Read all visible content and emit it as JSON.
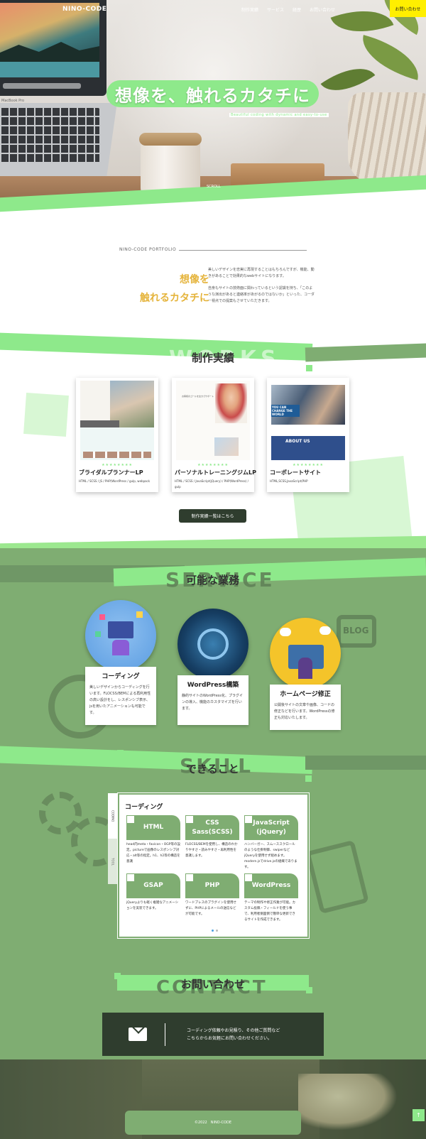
{
  "header": {
    "logo": "NINO-CODE",
    "nav": [
      "制作実績",
      "サービス",
      "経歴",
      "お問い合わせ"
    ],
    "contact_button": "お問い合わせ"
  },
  "hero": {
    "title": "想像を、触れるカタチに",
    "subtitle": "Beautiful coding with dynamic and easy-to-use",
    "scroll": "SCROLL",
    "laptop_label": "MacBook Pro"
  },
  "about": {
    "heading": "NINO-CODE PORTFOLIO",
    "tagline": [
      "想像を",
      "触れるカタチに"
    ],
    "paragraphs": [
      "美しいデザインを忠実に再現することはもちろんですが、機能、動きがあることで効果的なwebサイトになります。",
      "自身もサイトの技術面に関わっているという認識を持ち、「このような演出があると連絡率があがるのではないか」といった、コーダー視点での提案もさせていただきます。"
    ]
  },
  "works": {
    "ghost": "WORKS",
    "title": "制作実績",
    "cards": [
      {
        "title": "ブライダルプランナーLP",
        "tags": "HTML / SCSS / JS / PHP(WordPress / gulp, webpack",
        "stars": "★★★★★★★★"
      },
      {
        "title": "パーソナルトレーニングジムLP",
        "tags": "HTML / SCSS / JavaScript(jQuery) / PHP(WordPress) / gulp",
        "stars": "★★★★★★★★"
      },
      {
        "title": "コーポレートサイト",
        "tags": "HTML,SCSS,JavaScript(PHP",
        "stars": "★★★★★★★★"
      }
    ],
    "card2_text": "お客様のゴールを全力でサポート",
    "card3_texts": [
      "YOU CAN CHANGE THE WORLD",
      "ABOUT US"
    ],
    "button": "制作実績一覧はこちら"
  },
  "service": {
    "ghost": "SERVICE",
    "title": "可能な業務",
    "bg_icon_text": "BLOG",
    "items": [
      {
        "title": "コーディング",
        "desc": "美しいデザインからコーディングを行います。FLOCSS/BEMによる再利用性の高い設計をし、レスポンシブ表示、jsを用いたアニメーションも可能です。"
      },
      {
        "title": "WordPress構築",
        "desc": "静的サイトのWordPress化、プラグインの導入、機能のカスタマイズを行います。"
      },
      {
        "title": "ホームページ修正",
        "desc": "公開後サイトの文章や画像、コードの修正などを行います。WordPressの修正も対応いたします。"
      }
    ]
  },
  "skill": {
    "ghost": "SKILL",
    "title": "できること",
    "tabs": [
      "CODING",
      "TOOL"
    ],
    "panel_heading": "コーディング",
    "items": [
      {
        "name": "HTML",
        "desc": "head内meta・favicon・OGP等の設定。pictureで画像のレスポンシブ対応・alt等の指定。h1、h2等の構造を意識"
      },
      {
        "name": "CSS\nSass(SCSS)",
        "desc": "FLOCSS/BEMを使用し、構造のわかりやすさ・読みやすさ・再利用性を意識します。"
      },
      {
        "name": "JavaScript\n(jQuery)",
        "desc": "ハンバーガー、スムーススクロールのような仕掛制御、swiperなどjQueryを使用せず組めます。modern.jsでdrive.jsの組織であります。"
      },
      {
        "name": "GSAP",
        "desc": "jQueryよりも軽く複雑なアニメーションを実装できます。"
      },
      {
        "name": "PHP",
        "desc": "ワードプレスのプラグインを使用せずに、PHPによるメールの送信などが可能です。"
      },
      {
        "name": "WordPress",
        "desc": "テーマの制作や修正作業が可能。カスタム投稿・フィールドを使う事で、利用者側面倒で簡単な更新できるサイトを作成できます。"
      }
    ]
  },
  "contact": {
    "ghost": "CONTACT",
    "title": "お問い合わせ",
    "text": [
      "コーディング依頼やお見積り、その他ご質問など",
      "こちらからお気軽にお問い合わせください。"
    ]
  },
  "footer": {
    "copyright": "©2022　NINO-CODE",
    "totop": "↑"
  },
  "colors": {
    "accent_green": "#8ee98b",
    "section_green": "#7fad72",
    "dark": "#2f3d2e",
    "yellow": "#ffef00",
    "gold": "#e5b43c"
  }
}
